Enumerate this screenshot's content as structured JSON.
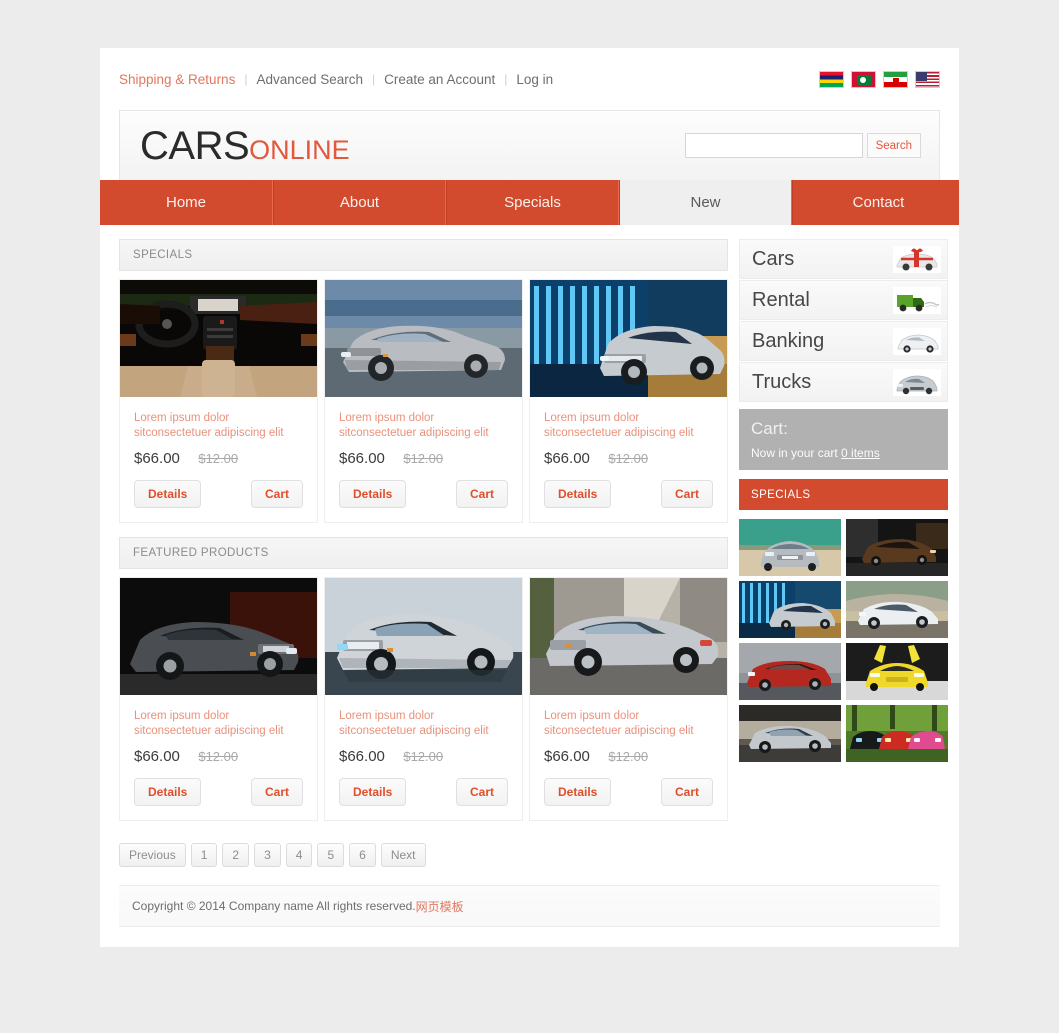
{
  "topbar": {
    "links": [
      {
        "label": "Shipping & Returns",
        "accent": true
      },
      {
        "label": "Advanced Search",
        "accent": false
      },
      {
        "label": "Create an Account",
        "accent": false
      },
      {
        "label": "Log in",
        "accent": false
      }
    ],
    "separator": "|",
    "flags": [
      "mauritius-flag",
      "maldives-flag",
      "iran-flag",
      "usa-flag"
    ]
  },
  "brand": {
    "name_primary": "CARS",
    "name_secondary": "ONLINE"
  },
  "search": {
    "value": "",
    "placeholder": "",
    "button_label": "Search",
    "icon": "search-icon"
  },
  "nav": {
    "items": [
      {
        "label": "Home",
        "active": false
      },
      {
        "label": "About",
        "active": false
      },
      {
        "label": "Specials",
        "active": false
      },
      {
        "label": "New",
        "active": true
      },
      {
        "label": "Contact",
        "active": false
      }
    ],
    "accent_color": "#d24b2e",
    "active_bg": "#efefef"
  },
  "main": {
    "sections": [
      {
        "title": "SPECIALS"
      },
      {
        "title": "FEATURED PRODUCTS"
      }
    ],
    "specials_products": [
      {
        "image": "car-interior-dashboard-photo",
        "description": "Lorem ipsum dolor sitconsectetuer adipiscing elit",
        "price": "$66.00",
        "old_price": "$12.00",
        "details_label": "Details",
        "cart_label": "Cart"
      },
      {
        "image": "silver-sedan-motion-photo",
        "description": "Lorem ipsum dolor sitconsectetuer adipiscing elit",
        "price": "$66.00",
        "old_price": "$12.00",
        "details_label": "Details",
        "cart_label": "Cart"
      },
      {
        "image": "silver-sedan-blue-lights-photo",
        "description": "Lorem ipsum dolor sitconsectetuer adipiscing elit",
        "price": "$66.00",
        "old_price": "$12.00",
        "details_label": "Details",
        "cart_label": "Cart"
      }
    ],
    "featured_products": [
      {
        "image": "dark-grey-sedan-photo",
        "description": "Lorem ipsum dolor sitconsectetuer adipiscing elit",
        "price": "$66.00",
        "old_price": "$12.00",
        "details_label": "Details",
        "cart_label": "Cart"
      },
      {
        "image": "silver-sedan-studio-photo",
        "description": "Lorem ipsum dolor sitconsectetuer adipiscing elit",
        "price": "$66.00",
        "old_price": "$12.00",
        "details_label": "Details",
        "cart_label": "Cart"
      },
      {
        "image": "silver-sedan-garage-photo",
        "description": "Lorem ipsum dolor sitconsectetuer adipiscing elit",
        "price": "$66.00",
        "old_price": "$12.00",
        "details_label": "Details",
        "cart_label": "Cart"
      }
    ]
  },
  "sidebar": {
    "categories": [
      {
        "label": "Cars",
        "thumb": "red-ribbon-car-icon"
      },
      {
        "label": "Rental",
        "thumb": "green-truck-icon"
      },
      {
        "label": "Banking",
        "thumb": "white-coupe-icon"
      },
      {
        "label": "Trucks",
        "thumb": "silver-car-icon"
      }
    ],
    "cart": {
      "title": "Cart:",
      "text": "Now in your cart",
      "count_label": "0 items"
    },
    "specials_title": "SPECIALS",
    "specials_thumbs": [
      "grey-sedan-front-photo",
      "brown-sedan-night-photo",
      "silver-sedan-blue-photo",
      "white-coupe-tunnel-photo",
      "red-wagon-photo",
      "yellow-supercar-photo",
      "silver-coupe-photo",
      "three-colored-cars-photo"
    ]
  },
  "pagination": {
    "previous_label": "Previous",
    "pages": [
      "1",
      "2",
      "3",
      "4",
      "5",
      "6"
    ],
    "next_label": "Next"
  },
  "footer": {
    "copyright": "Copyright © 2014 Company name All rights reserved.",
    "credit_link": "网页模板"
  }
}
